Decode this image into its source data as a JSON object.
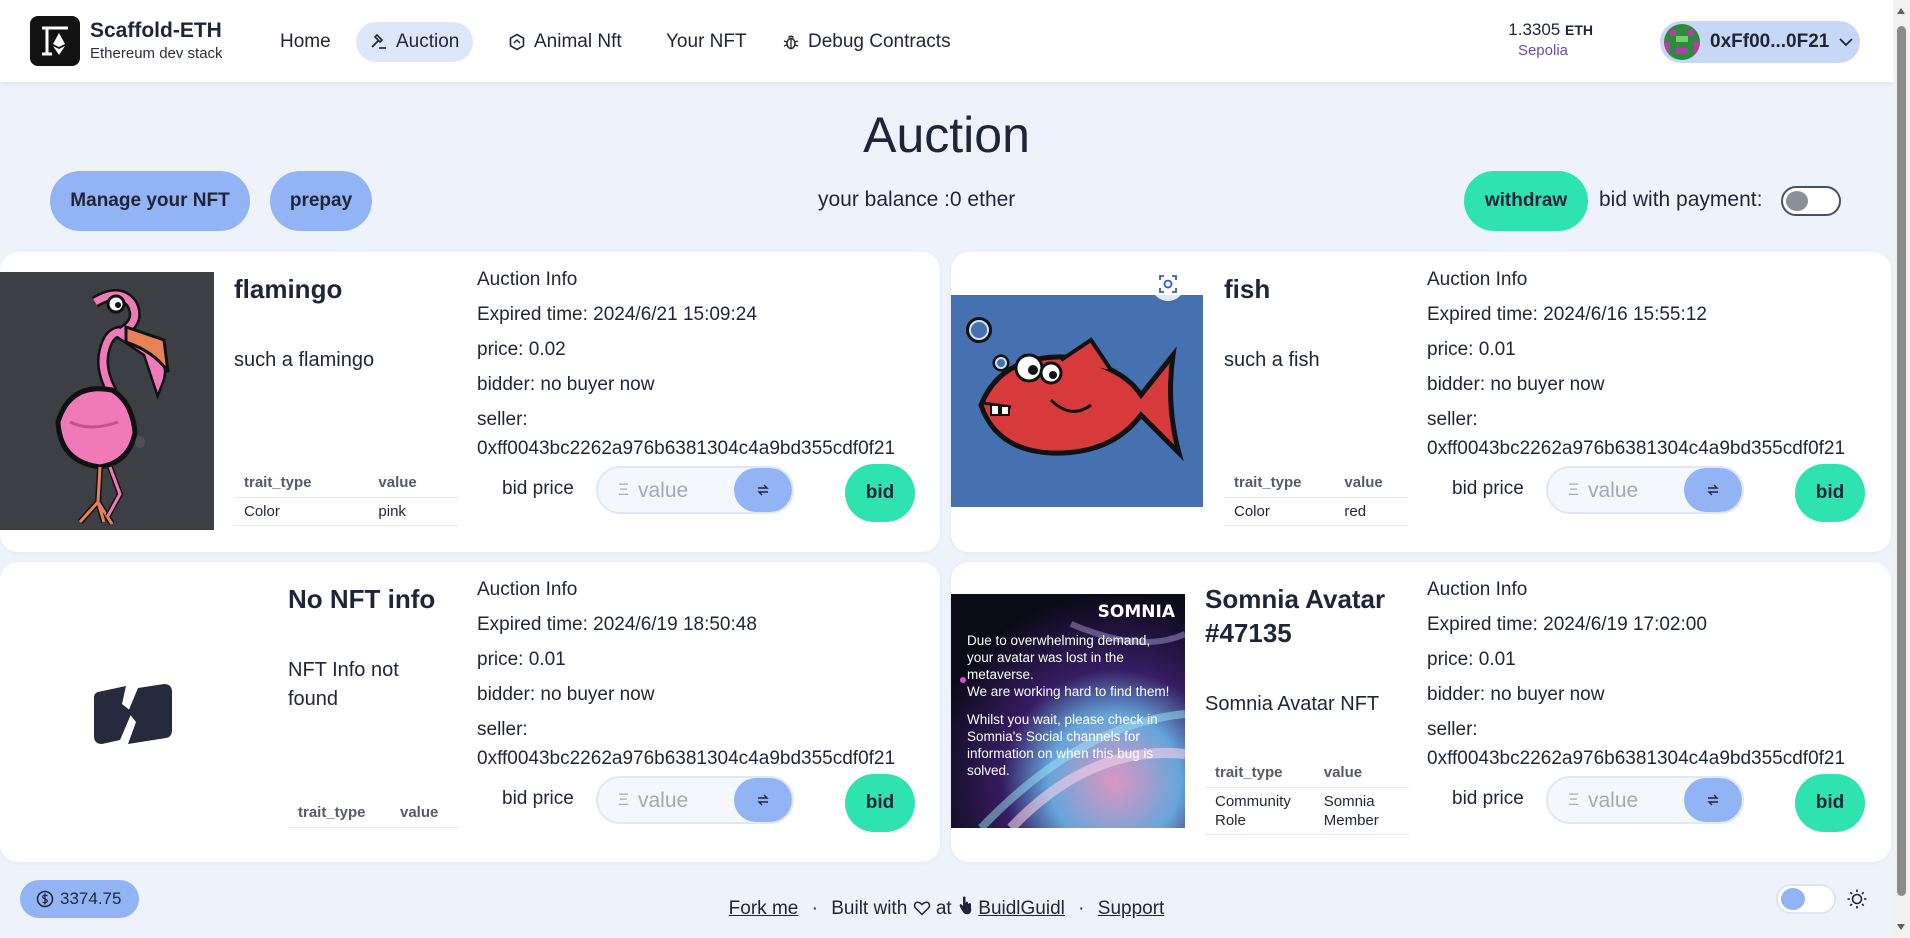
{
  "header": {
    "brand_title": "Scaffold-ETH",
    "brand_sub": "Ethereum dev stack",
    "nav": [
      {
        "label": "Home",
        "icon": "none"
      },
      {
        "label": "Auction",
        "icon": "hammer-icon"
      },
      {
        "label": "Animal Nft",
        "icon": "hexagon-icon"
      },
      {
        "label": "Your NFT",
        "icon": "none"
      },
      {
        "label": "Debug Contracts",
        "icon": "bug-icon"
      }
    ],
    "eth_amount": "1.3305",
    "eth_unit": "ETH",
    "network": "Sepolia",
    "account": "0xFf00...0F21"
  },
  "page": {
    "title": "Auction",
    "manage_label": "Manage your NFT",
    "prepay_label": "prepay",
    "balance_text": "your balance :0 ether",
    "withdraw_label": "withdraw",
    "bid_with_payment_label": "bid with payment:"
  },
  "common": {
    "auction_info_label": "Auction Info",
    "bid_price_label": "bid price",
    "bid_placeholder": "value",
    "bid_button": "bid",
    "trait_type_header": "trait_type",
    "value_header": "value",
    "eth_symbol": "Ξ"
  },
  "cards": [
    {
      "name": "flamingo",
      "description": "such a flamingo",
      "expired": "Expired time: 2024/6/21 15:09:24",
      "price": "price: 0.02",
      "bidder": "bidder: no buyer now",
      "seller_label": "seller:",
      "seller": "0xff0043bc2262a976b6381304c4a9bd355cdf0f21",
      "traits": [
        {
          "type": "Color",
          "value": "pink"
        }
      ]
    },
    {
      "name": "fish",
      "description": "such a fish",
      "expired": "Expired time: 2024/6/16 15:55:12",
      "price": "price: 0.01",
      "bidder": "bidder: no buyer now",
      "seller_label": "seller:",
      "seller": "0xff0043bc2262a976b6381304c4a9bd355cdf0f21",
      "traits": [
        {
          "type": "Color",
          "value": "red"
        }
      ]
    },
    {
      "name": "No NFT info",
      "description": "NFT Info not found",
      "expired": "Expired time: 2024/6/19 18:50:48",
      "price": "price: 0.01",
      "bidder": "bidder: no buyer now",
      "seller_label": "seller:",
      "seller": "0xff0043bc2262a976b6381304c4a9bd355cdf0f21",
      "traits": []
    },
    {
      "name": "Somnia Avatar #47135",
      "description": "Somnia Avatar NFT",
      "expired": "Expired time: 2024/6/19 17:02:00",
      "price": "price: 0.01",
      "bidder": "bidder: no buyer now",
      "seller_label": "seller:",
      "seller": "0xff0043bc2262a976b6381304c4a9bd355cdf0f21",
      "traits": [
        {
          "type": "Community Role",
          "value": "Somnia Member"
        }
      ],
      "image_text": {
        "logo": "SOMNIA",
        "message_1": "Due to overwhelming demand, your avatar was lost in the metaverse.",
        "message_2": "We are working hard to find them!",
        "message_3": "Whilst you wait, please check in Somnia's Social channels for information on when this bug is solved."
      }
    }
  ],
  "footer": {
    "price": "3374.75",
    "fork_me": "Fork me",
    "built_with": "Built with",
    "at": "at",
    "buidlguidl": "BuidlGuidl",
    "support": "Support"
  },
  "colors": {
    "accent_blue": "#92b4f4",
    "accent_green": "#2fe3b0",
    "background": "#eef3fb",
    "nav_active": "#dce7f9"
  }
}
